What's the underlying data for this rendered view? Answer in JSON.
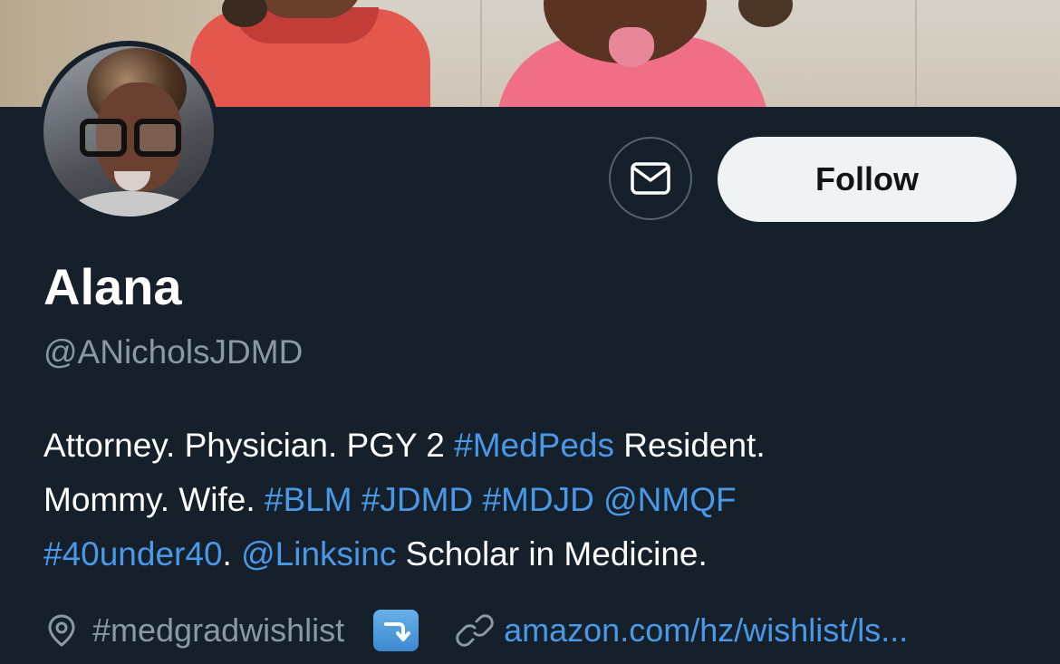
{
  "profile": {
    "name": "Alana",
    "handle": "@ANicholsJDMD",
    "follow_label": "Follow",
    "bio": {
      "line1": {
        "t1": "Attorney. Physician. PGY 2 ",
        "h1": "#MedPeds",
        "t2": " Resident."
      },
      "line2": {
        "t1": "Mommy. Wife. ",
        "h1": "#BLM",
        "sp1": " ",
        "h2": "#JDMD",
        "sp2": " ",
        "h3": "#MDJD",
        "sp3": " ",
        "h4": "@NMQF"
      },
      "line3": {
        "h1": "#40under40",
        "t1": ". ",
        "h2": "@Linksinc",
        "t2": " Scholar in Medicine."
      }
    },
    "location": "#medgradwishlist",
    "location_emoji": "arrow-right-curving-down-emoji",
    "website": "amazon.com/hz/wishlist/ls..."
  },
  "icons": {
    "message": "envelope-icon",
    "location": "location-pin-icon",
    "website": "link-icon"
  },
  "colors": {
    "background": "#15202b",
    "link": "#4a99e9",
    "secondary_text": "#8b98a5",
    "follow_bg": "#eff3f4"
  }
}
